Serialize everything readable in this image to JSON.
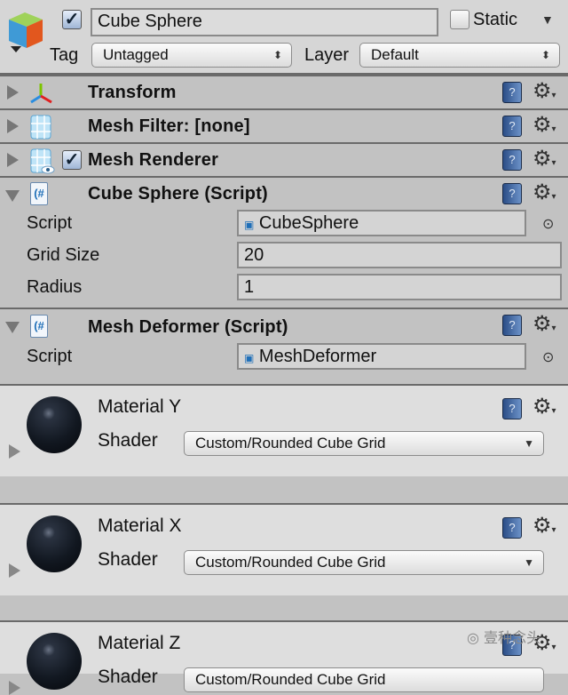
{
  "header": {
    "name": "Cube Sphere",
    "active": true,
    "static_label": "Static",
    "static": false,
    "tag_label": "Tag",
    "tag_value": "Untagged",
    "layer_label": "Layer",
    "layer_value": "Default"
  },
  "components": [
    {
      "title": "Transform",
      "icon": "transform-axes-icon",
      "expanded": false
    },
    {
      "title": "Mesh Filter: [none]",
      "icon": "mesh-filter-icon",
      "expanded": false
    },
    {
      "title": "Mesh Renderer",
      "icon": "mesh-renderer-icon",
      "expanded": false,
      "enabled": true
    },
    {
      "title": "Cube Sphere (Script)",
      "icon": "csharp-script-icon",
      "expanded": true,
      "fields": [
        {
          "label": "Script",
          "value": "CubeSphere"
        },
        {
          "label": "Grid Size",
          "value": "20"
        },
        {
          "label": "Radius",
          "value": "1"
        }
      ]
    },
    {
      "title": "Mesh Deformer (Script)",
      "icon": "csharp-script-icon",
      "expanded": true,
      "fields": [
        {
          "label": "Script",
          "value": "MeshDeformer"
        }
      ]
    }
  ],
  "materials": [
    {
      "name": "Material Y",
      "shader_label": "Shader",
      "shader": "Custom/Rounded Cube Grid"
    },
    {
      "name": "Material X",
      "shader_label": "Shader",
      "shader": "Custom/Rounded Cube Grid"
    },
    {
      "name": "Material Z",
      "shader_label": "Shader",
      "shader": "Custom/Rounded Cube Grid"
    }
  ],
  "help_glyph": "?",
  "watermark": "壹种念头"
}
